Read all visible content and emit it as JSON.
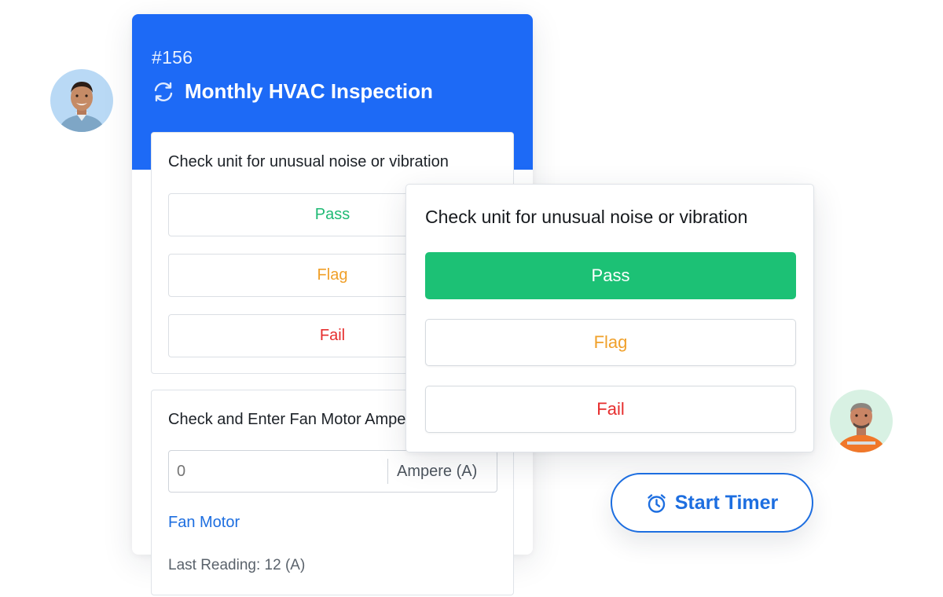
{
  "work_order": {
    "number": "#156",
    "title": "Monthly HVAC Inspection",
    "icon": "sync-icon"
  },
  "back_task": {
    "question": "Check unit for unusual noise or vibration",
    "options": [
      "Pass",
      "Flag",
      "Fail"
    ]
  },
  "meter_task": {
    "question": "Check and Enter Fan Motor Ampere",
    "input_placeholder": "0",
    "unit": "Ampere (A)",
    "meter_link": "Fan Motor",
    "last_reading": "Last Reading: 12 (A)"
  },
  "front_task": {
    "question": "Check unit for unusual noise or vibration",
    "options": [
      "Pass",
      "Flag",
      "Fail"
    ],
    "selected": "Pass"
  },
  "timer": {
    "label": "Start Timer",
    "icon": "stopwatch-icon"
  },
  "colors": {
    "header_blue": "#1d6af6",
    "pass_green": "#1cc175",
    "flag_orange": "#f0a02a",
    "fail_red": "#e62d2d",
    "link_blue": "#1d6ee0"
  }
}
